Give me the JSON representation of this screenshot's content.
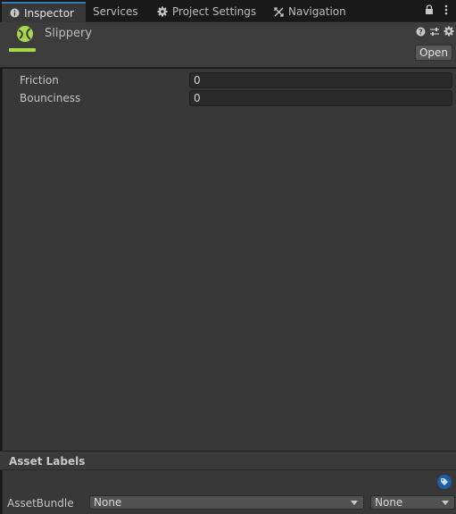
{
  "tabs": [
    {
      "label": "Inspector",
      "icon": "info-icon",
      "active": true
    },
    {
      "label": "Services",
      "icon": "",
      "active": false
    },
    {
      "label": "Project Settings",
      "icon": "gear-icon",
      "active": false
    },
    {
      "label": "Navigation",
      "icon": "navigation-icon",
      "active": false
    }
  ],
  "tabbar_icons": [
    "lock-icon",
    "kebab-menu-icon"
  ],
  "header": {
    "title": "Slippery",
    "asset_icon": "physics-material-icon",
    "accent_color": "#a8d94c",
    "icons": [
      "help-icon",
      "presets-icon",
      "settings-icon"
    ],
    "open_label": "Open"
  },
  "properties": [
    {
      "label": "Friction",
      "value": "0"
    },
    {
      "label": "Bounciness",
      "value": "0"
    }
  ],
  "asset_labels": {
    "title": "Asset Labels",
    "tag_icon": "tag-icon",
    "asset_bundle_label": "AssetBundle",
    "bundle_value": "None",
    "variant_value": "None"
  },
  "colors": {
    "active_tab_border": "#3a79bb",
    "panel_bg": "#383838",
    "tag_button": "#1f5ea8"
  }
}
